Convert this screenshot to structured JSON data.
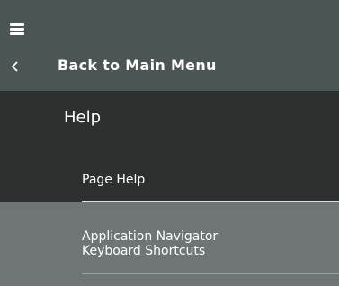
{
  "nav": {
    "menu_icon": "hamburger-menu-icon",
    "back_icon": "chevron-left-icon",
    "back_label": "Back to Main Menu"
  },
  "section": {
    "title": "Help"
  },
  "menu": {
    "items": [
      {
        "label": "Page Help",
        "selected": true
      },
      {
        "label_line1": "Application Navigator",
        "label_line2": "Keyboard Shortcuts",
        "selected": false
      }
    ]
  },
  "colors": {
    "header_bg": "#4b5554",
    "section_bg": "#2c3130",
    "menu_bg": "#6e7574",
    "text": "#ffffff"
  }
}
